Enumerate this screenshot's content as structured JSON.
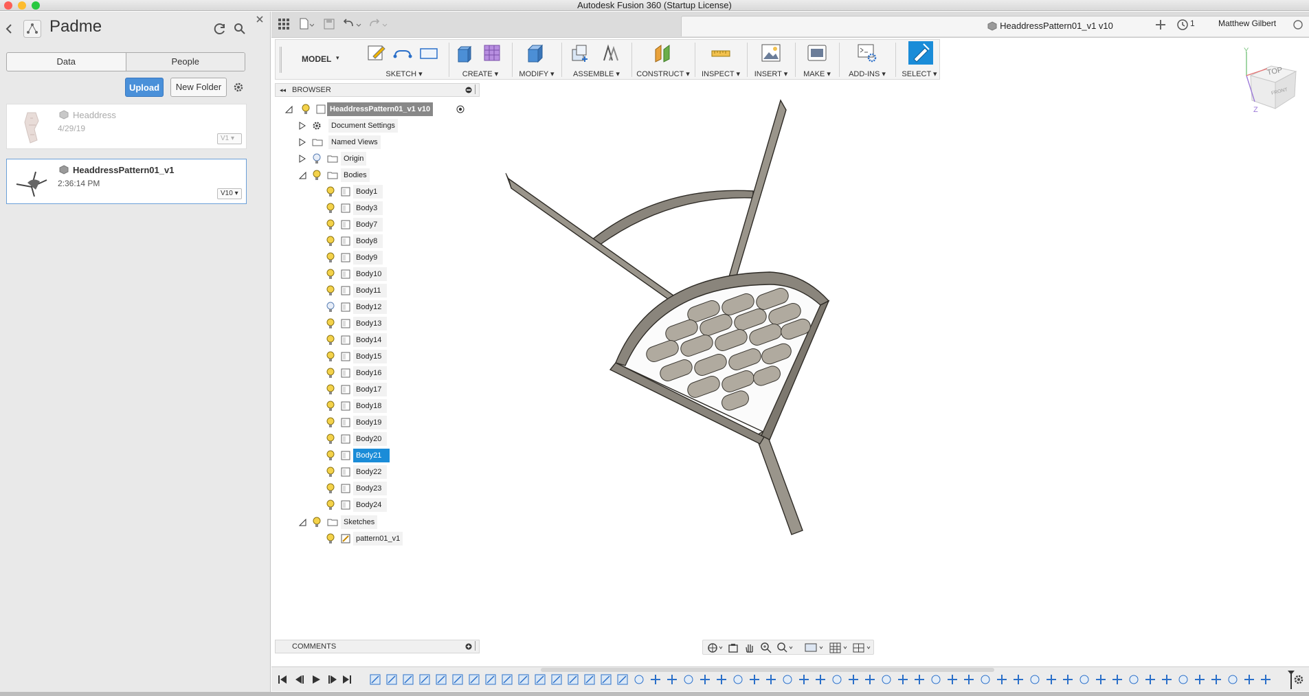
{
  "window": {
    "title": "Autodesk Fusion 360 (Startup License)"
  },
  "data_panel": {
    "project_name": "Padme",
    "tabs": [
      "Data",
      "People"
    ],
    "upload_label": "Upload",
    "new_folder_label": "New Folder",
    "files": [
      {
        "name": "Headdress",
        "date": "4/29/19",
        "version": "V1"
      },
      {
        "name": "HeaddressPattern01_v1",
        "date": "2:36:14 PM",
        "version": "V10"
      }
    ]
  },
  "tabbar": {
    "document_tab": "HeaddressPattern01_v1 v10",
    "jobs_count": "1",
    "user_name": "Matthew Gilbert"
  },
  "toolbar": {
    "workspace": "MODEL",
    "groups": [
      "SKETCH",
      "CREATE",
      "MODIFY",
      "ASSEMBLE",
      "CONSTRUCT",
      "INSPECT",
      "INSERT",
      "MAKE",
      "ADD-INS",
      "SELECT"
    ]
  },
  "browser": {
    "title": "BROWSER",
    "root": "HeaddressPattern01_v1 v10",
    "nodes": [
      "Document Settings",
      "Named Views",
      "Origin",
      "Bodies"
    ],
    "bodies": [
      "Body1",
      "Body3",
      "Body7",
      "Body8",
      "Body9",
      "Body10",
      "Body11",
      "Body12",
      "Body13",
      "Body14",
      "Body15",
      "Body16",
      "Body17",
      "Body18",
      "Body19",
      "Body20",
      "Body21",
      "Body22",
      "Body23",
      "Body24"
    ],
    "selected_body": "Body21",
    "sketches_label": "Sketches",
    "sketches": [
      "pattern01_v1"
    ]
  },
  "viewcube": {
    "top": "TOP",
    "front": "FRONT",
    "axis_y": "Y",
    "axis_z": "Z"
  },
  "comments": {
    "title": "COMMENTS"
  },
  "colors": {
    "accent": "#1a8cd8",
    "upload": "#4a90d9",
    "select_tool": "#1a8cd8",
    "model_fill": "#8a857c"
  }
}
